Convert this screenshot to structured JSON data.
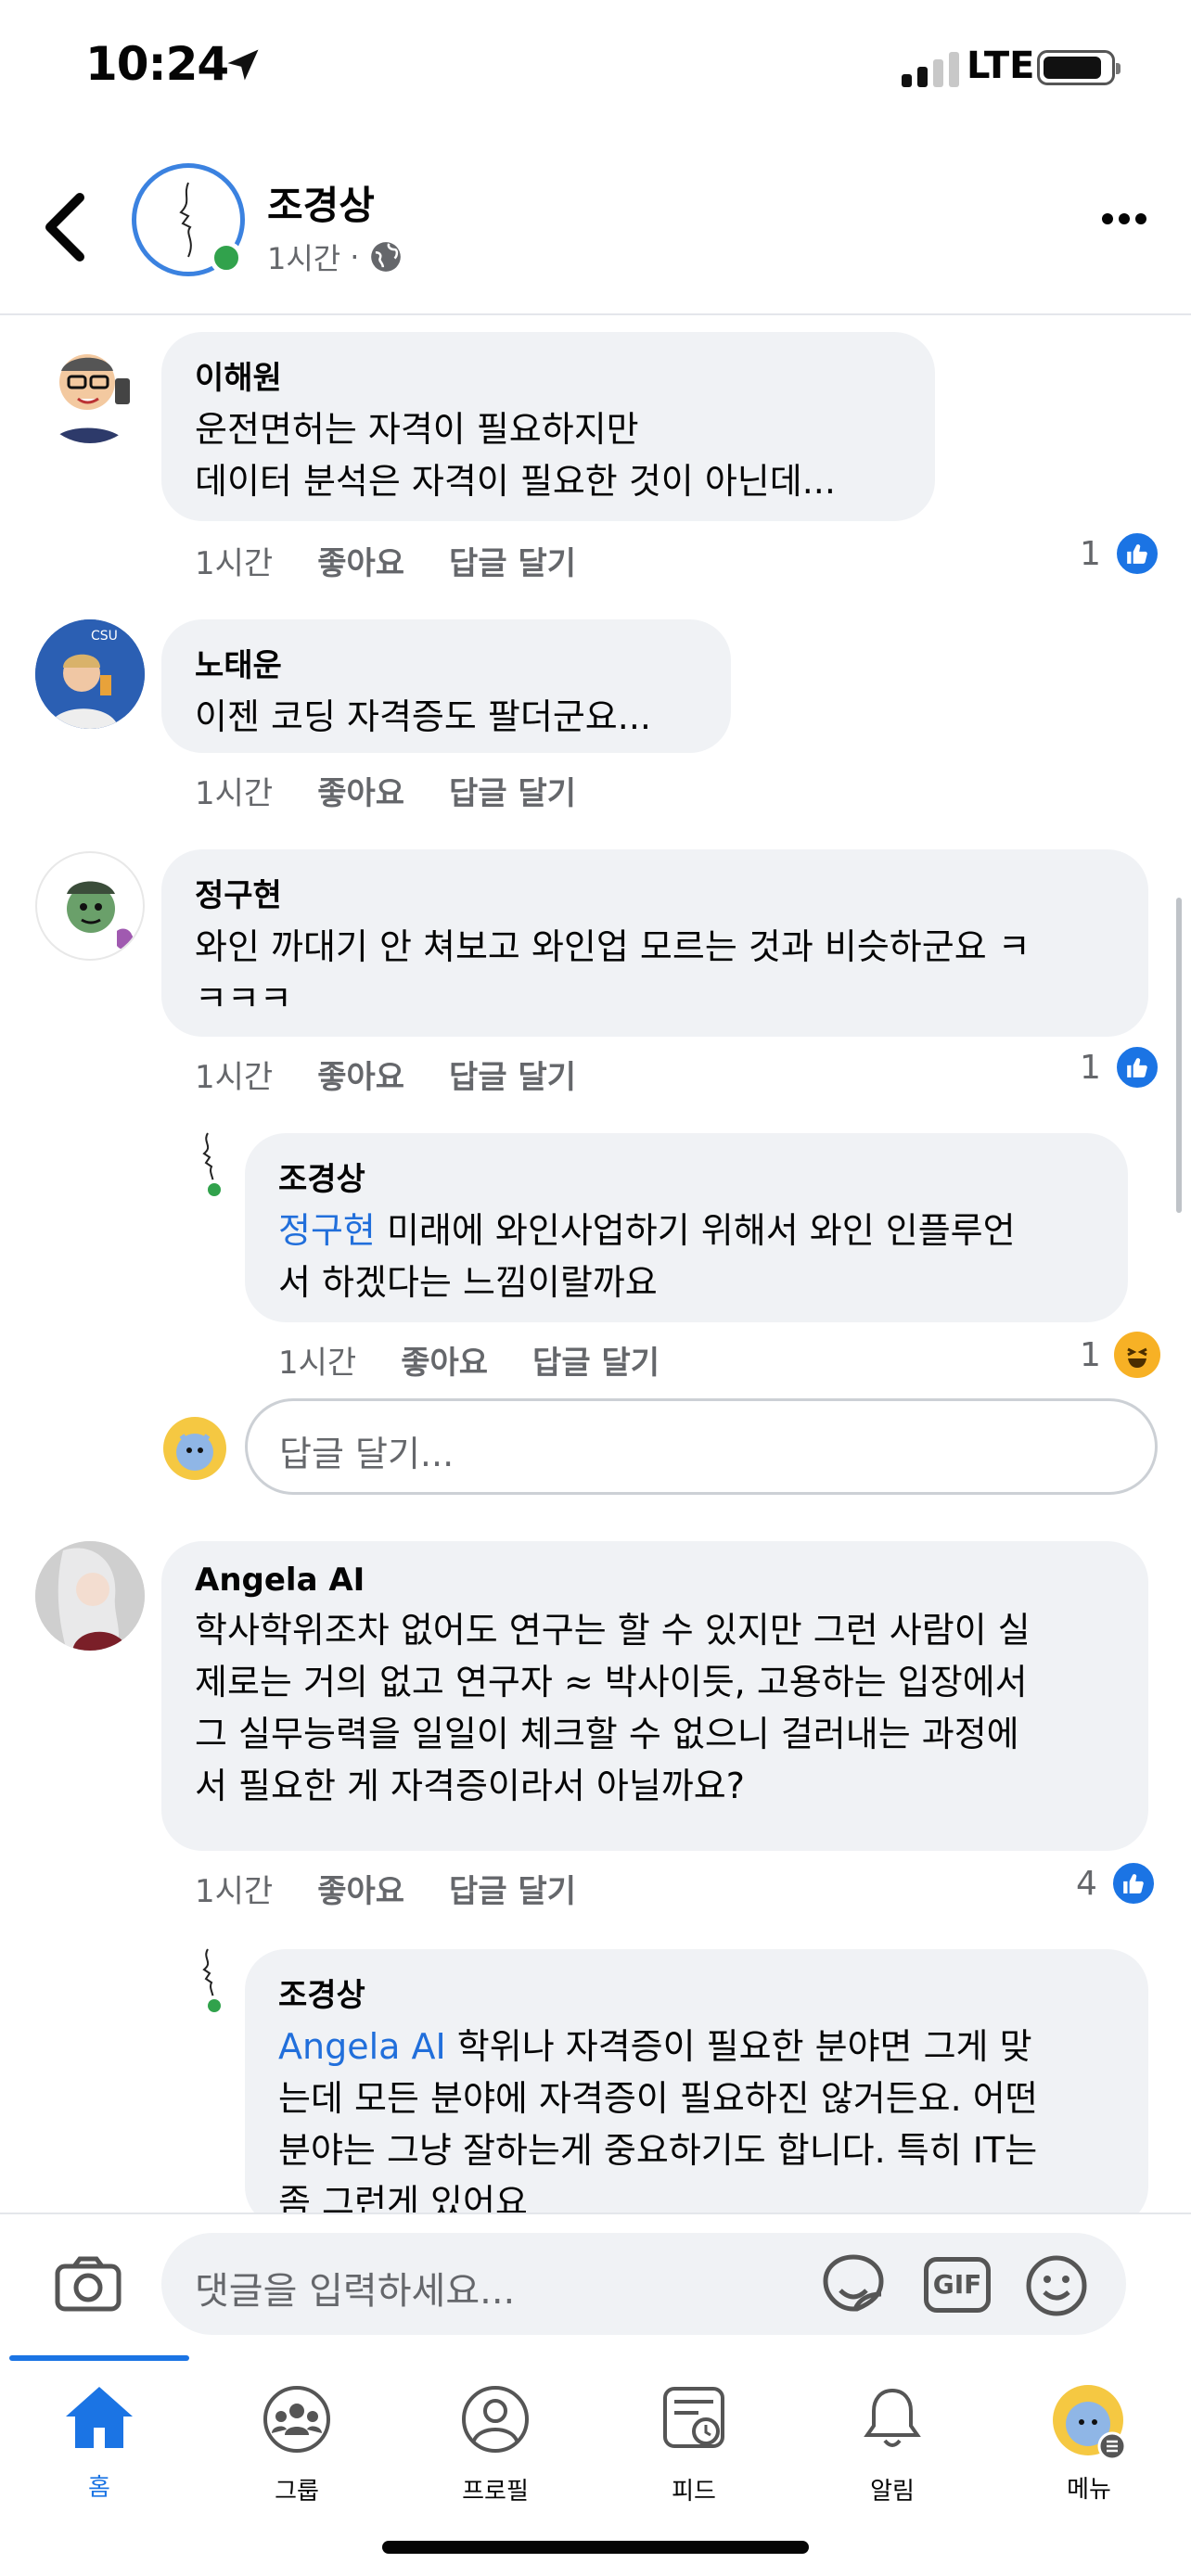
{
  "status": {
    "time": "10:24",
    "network": "LTE"
  },
  "header": {
    "name": "조경상",
    "time": "1시간",
    "separator": "·",
    "privacy_icon": "globe-icon"
  },
  "comments": [
    {
      "author": "이해원",
      "text": "운전면허는 자격이 필요하지만\n데이터 분석은 자격이 필요한 것이 아닌데...",
      "time": "1시간",
      "like": "좋아요",
      "reply": "답글 달기",
      "reaction_count": "1"
    },
    {
      "author": "노태운",
      "text": "이젠 코딩 자격증도 팔더군요...",
      "time": "1시간",
      "like": "좋아요",
      "reply": "답글 달기"
    },
    {
      "author": "정구현",
      "text": "와인 까대기 안 쳐보고 와인업 모르는 것과 비슷하군요 ㅋ\nㅋㅋㅋ",
      "time": "1시간",
      "like": "좋아요",
      "reply": "답글 달기",
      "reaction_count": "1"
    },
    {
      "author": "Angela AI",
      "text": "학사학위조차 없어도 연구는 할 수 있지만 그런 사람이 실\n제로는 거의 없고 연구자 ≈ 박사이듯, 고용하는 입장에서\n그 실무능력을 일일이 체크할 수 없으니 걸러내는 과정에\n서 필요한 게 자격증이라서 아닐까요?",
      "time": "1시간",
      "like": "좋아요",
      "reply": "답글 달기",
      "reaction_count": "4"
    }
  ],
  "replies": [
    {
      "author": "조경상",
      "mention": "정구현",
      "text": " 미래에 와인사업하기 위해서 와인 인플루언\n서 하겠다는 느낌이랄까요",
      "time": "1시간",
      "like": "좋아요",
      "reply": "답글 달기",
      "reaction_count": "1"
    },
    {
      "author": "조경상",
      "mention": "Angela AI",
      "text": " 학위나 자격증이 필요한 분야면 그게 맞\n는데 모든 분야에 자격증이 필요하진 않거든요. 어떤\n분야는 그냥 잘하는게 중요하기도 합니다. 특히 IT는\n좀 그런게 있어요"
    }
  ],
  "reply_box": {
    "placeholder": "답글 달기..."
  },
  "composer": {
    "placeholder": "댓글을 입력하세요...",
    "gif": "GIF"
  },
  "tabs": [
    {
      "label": "홈",
      "icon": "home-icon"
    },
    {
      "label": "그룹",
      "icon": "groups-icon"
    },
    {
      "label": "프로필",
      "icon": "profile-icon"
    },
    {
      "label": "피드",
      "icon": "feeds-icon"
    },
    {
      "label": "알림",
      "icon": "bell-icon"
    },
    {
      "label": "메뉴",
      "icon": "menu-avatar-icon"
    }
  ],
  "colors": {
    "accent": "#1b74e4",
    "online": "#31a24c",
    "bubble": "#f0f2f5",
    "muted": "#65676b"
  }
}
